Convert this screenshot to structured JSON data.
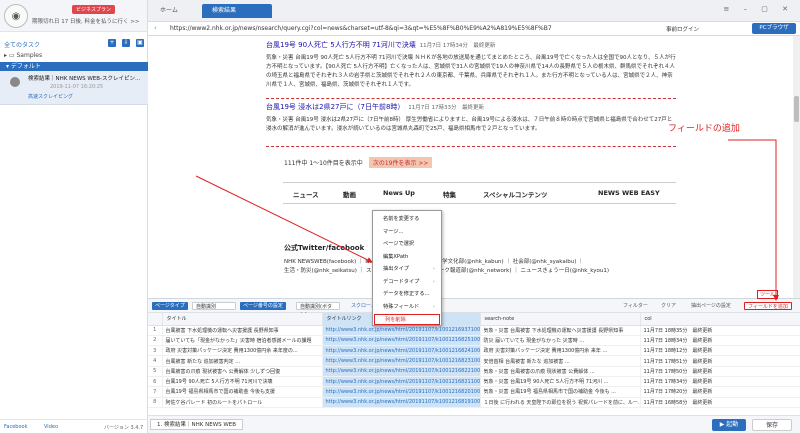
{
  "sidebar": {
    "plan_badge": "ビジネスプラン",
    "expire_notice": "期限切れ日 17 日後, 料金を払うに行く >>",
    "all_tasks": "全てのタスク",
    "samples": "Samples",
    "default_group": "デフォルト",
    "task": {
      "title": "検索結果｜NHK NEWS WEB-スクレイピン...",
      "date": "2019-11-07 16:20:25",
      "cloud_label": "高速スクレイピング"
    },
    "footer": {
      "facebook": "Facebook",
      "video": "Video",
      "version": "バージョン 3.4.7"
    }
  },
  "browser": {
    "tabs": [
      {
        "label": "ホーム"
      },
      {
        "label": "検索結果"
      }
    ],
    "url": "https://www2.nhk.or.jp/news/nsearch/query.cgi?col=news&charset=utf-8&qi=3&qt=%E5%8F%B0%E9%A2%A819%E5%8F%B7",
    "prelogin_label": "事前ログイン",
    "browser_button": "PCブラウザ"
  },
  "page": {
    "articles": [
      {
        "title": "台風19号 90人死亡 5人行方不明 71河川で決壊",
        "meta": "11月7日 17時34分　最終更新",
        "body": "気象・災害 台風19号 90人死亡 5人行方不明 71河川で決壊 ＮＨＫが各地の放送局を通じてまとめたところ、台風19号で亡くなった人は全国で90人となり、５人が行方不明となっています。【90人死亡 5人行方不明】亡くなった人は、宮城県で31人の宮城県で19人の神奈川県で14人の長野県で５人の栃木県、群馬県でそれぞれ４人の埼玉県と福島県でそれぞれ３人の岩手県と茨城県でそれぞれ２人の東京都、千葉県、兵庫県でそれぞれ１人。また行方不明となっている人は、宮城県で２人、神奈川県で１人、宮城県、福島県、茨城県でそれぞれ１人です。"
      },
      {
        "title": "台風19号 浸水は2県27戸に（7日午前8時）",
        "meta": "11月7日 17時33分　最終更新",
        "body": "気象・災害 台風19号 浸水は2県27戸に（7日午前8時） 厚生労働省によりますと、台風19号による浸水は、７日午前８時の時点で宮城県と福島県で合わせて27戸と浸水の解消が進んでいます。浸水が続いているのは宮城県丸森町で25戸、福島県相馬市で２戸となっています。"
      }
    ],
    "pager_text": "111件中 1〜10件目を表示中",
    "next_label": "次の19件を表示 >>",
    "nav": [
      "ニュース",
      "動画",
      "News Up",
      "特集",
      "スペシャルコンテンツ",
      "NEWS WEB EASY"
    ],
    "twitter_title": "公式Twitter/facebook",
    "twitter_lines": [
      "NHK NEWSWEB(facebook) ｜ N...　　　　　...動　　　｜ 科学文化部(@nhk_kabun) ｜ 社会部(@nhk_syakaibu) ｜",
      "生活・防災(@nhk_seikatsu) ｜ スポ...　　　　　｜ ネットワーク報道部(@nhk_network) ｜ ニュースきょう一日(@nhk_kyou1)"
    ],
    "annotation": "フィールドの追加"
  },
  "context_menu": {
    "items": [
      {
        "label": "名前を変更する",
        "arrow": false
      },
      {
        "label": "マージ...",
        "arrow": false
      },
      {
        "label": "ページで選択",
        "arrow": false
      },
      {
        "label": "編集XPath",
        "arrow": false
      },
      {
        "label": "抽出タイプ",
        "arrow": true
      },
      {
        "label": "デコードタイプ",
        "arrow": true
      },
      {
        "label": "データを修正する...",
        "arrow": false
      },
      {
        "label": "特殊フィールド",
        "arrow": true
      },
      {
        "label": "列を削除",
        "arrow": false
      }
    ]
  },
  "panel": {
    "toolbar": {
      "page_type": "ページタイプ",
      "auto1": "自動識別",
      "page_settings": "ページ番号の設定",
      "auto2": "自動識別(ボタン)",
      "scroll": "スクロール",
      "filter": "フィルター",
      "clear": "クリア",
      "extract": "抽出ページの設定",
      "add_field": "フィールドを追加",
      "tip": "ツール"
    },
    "columns": [
      "",
      "タイトル",
      "タイトルリンク",
      "search-note",
      "col"
    ],
    "rows": [
      [
        "1",
        "台風被害 下水処理機の運転へ災害援護 長野県知事",
        "http://www3.nhk.or.jp/news/html/20191107/k10012169371000.html",
        "気象・災害 台風被害 下水処理機の運転へ災害援護 長野県知事",
        "11月7日 18時35分　最終更新"
      ],
      [
        "2",
        "届いていても「現金がなかった」災害時 宿泊者感謝メールの課題",
        "http://www3.nhk.or.jp/news/html/20191107/k10012168251000.html",
        "防災 届いていても 現金がなかった 災害時 ...",
        "11月7日 18時34分　最終更新"
      ],
      [
        "3",
        "政府 災害対策パッケージ決定 費用1300億円余 来年度の...",
        "http://www3.nhk.or.jp/news/html/20191107/k10012168241000.html",
        "政府 災害対策パッケージ決定 費用1300億円余 来年 ...",
        "11月7日 18時12分　最終更新"
      ],
      [
        "4",
        "台風被害 新たな 追加被害判定 ...",
        "http://www3.nhk.or.jp/news/html/20191107/k10012168231000.html",
        "安倍首相 台風被害 新たな 追加被害 ...",
        "11月7日 17時51分　最終更新"
      ],
      [
        "5",
        "台風被害の爪痕 現状被害へ 公費解体 少しずつ回復",
        "http://www3.nhk.or.jp/news/html/20191107/k10012168221000.html",
        "気象・災害 台風被害の爪痕 現状被害 公費解体 ...",
        "11月7日 17時50分　最終更新"
      ],
      [
        "6",
        "台風19号 90人死亡 5人行方不明 71河川で決壊",
        "http://www3.nhk.or.jp/news/html/20191107/k10012168211000.html",
        "気象・災害 台風19号 90人死亡 5人行方不明 71河川 ...",
        "11月7日 17時34分　最終更新"
      ],
      [
        "7",
        "台風19号 福島県相馬市で国の補助金 今後も支援",
        "http://www3.nhk.or.jp/news/html/20191107/k10012168201000.html",
        "気象・災害 台風19号 福島県相馬市で国の補助金 今後も ...",
        "11月7日 17時20分　最終更新"
      ],
      [
        "8",
        "阿佐ケ谷パレード 初のルートをパトロール",
        "http://www3.nhk.or.jp/news/html/20191107/k10012168191000.html",
        "１日後 に行われる 天皇陛下の即位を祝う 祝賀パレードを前に、ルー...",
        "11月7日 16時58分　最終更新"
      ]
    ]
  },
  "statusbar": {
    "tab": "1. 検索結果｜NHK NEWS WEB",
    "run": "▶ 起動",
    "save": "保存"
  },
  "colors": {
    "accent": "#2a6ebd",
    "annotation": "#e02020"
  }
}
